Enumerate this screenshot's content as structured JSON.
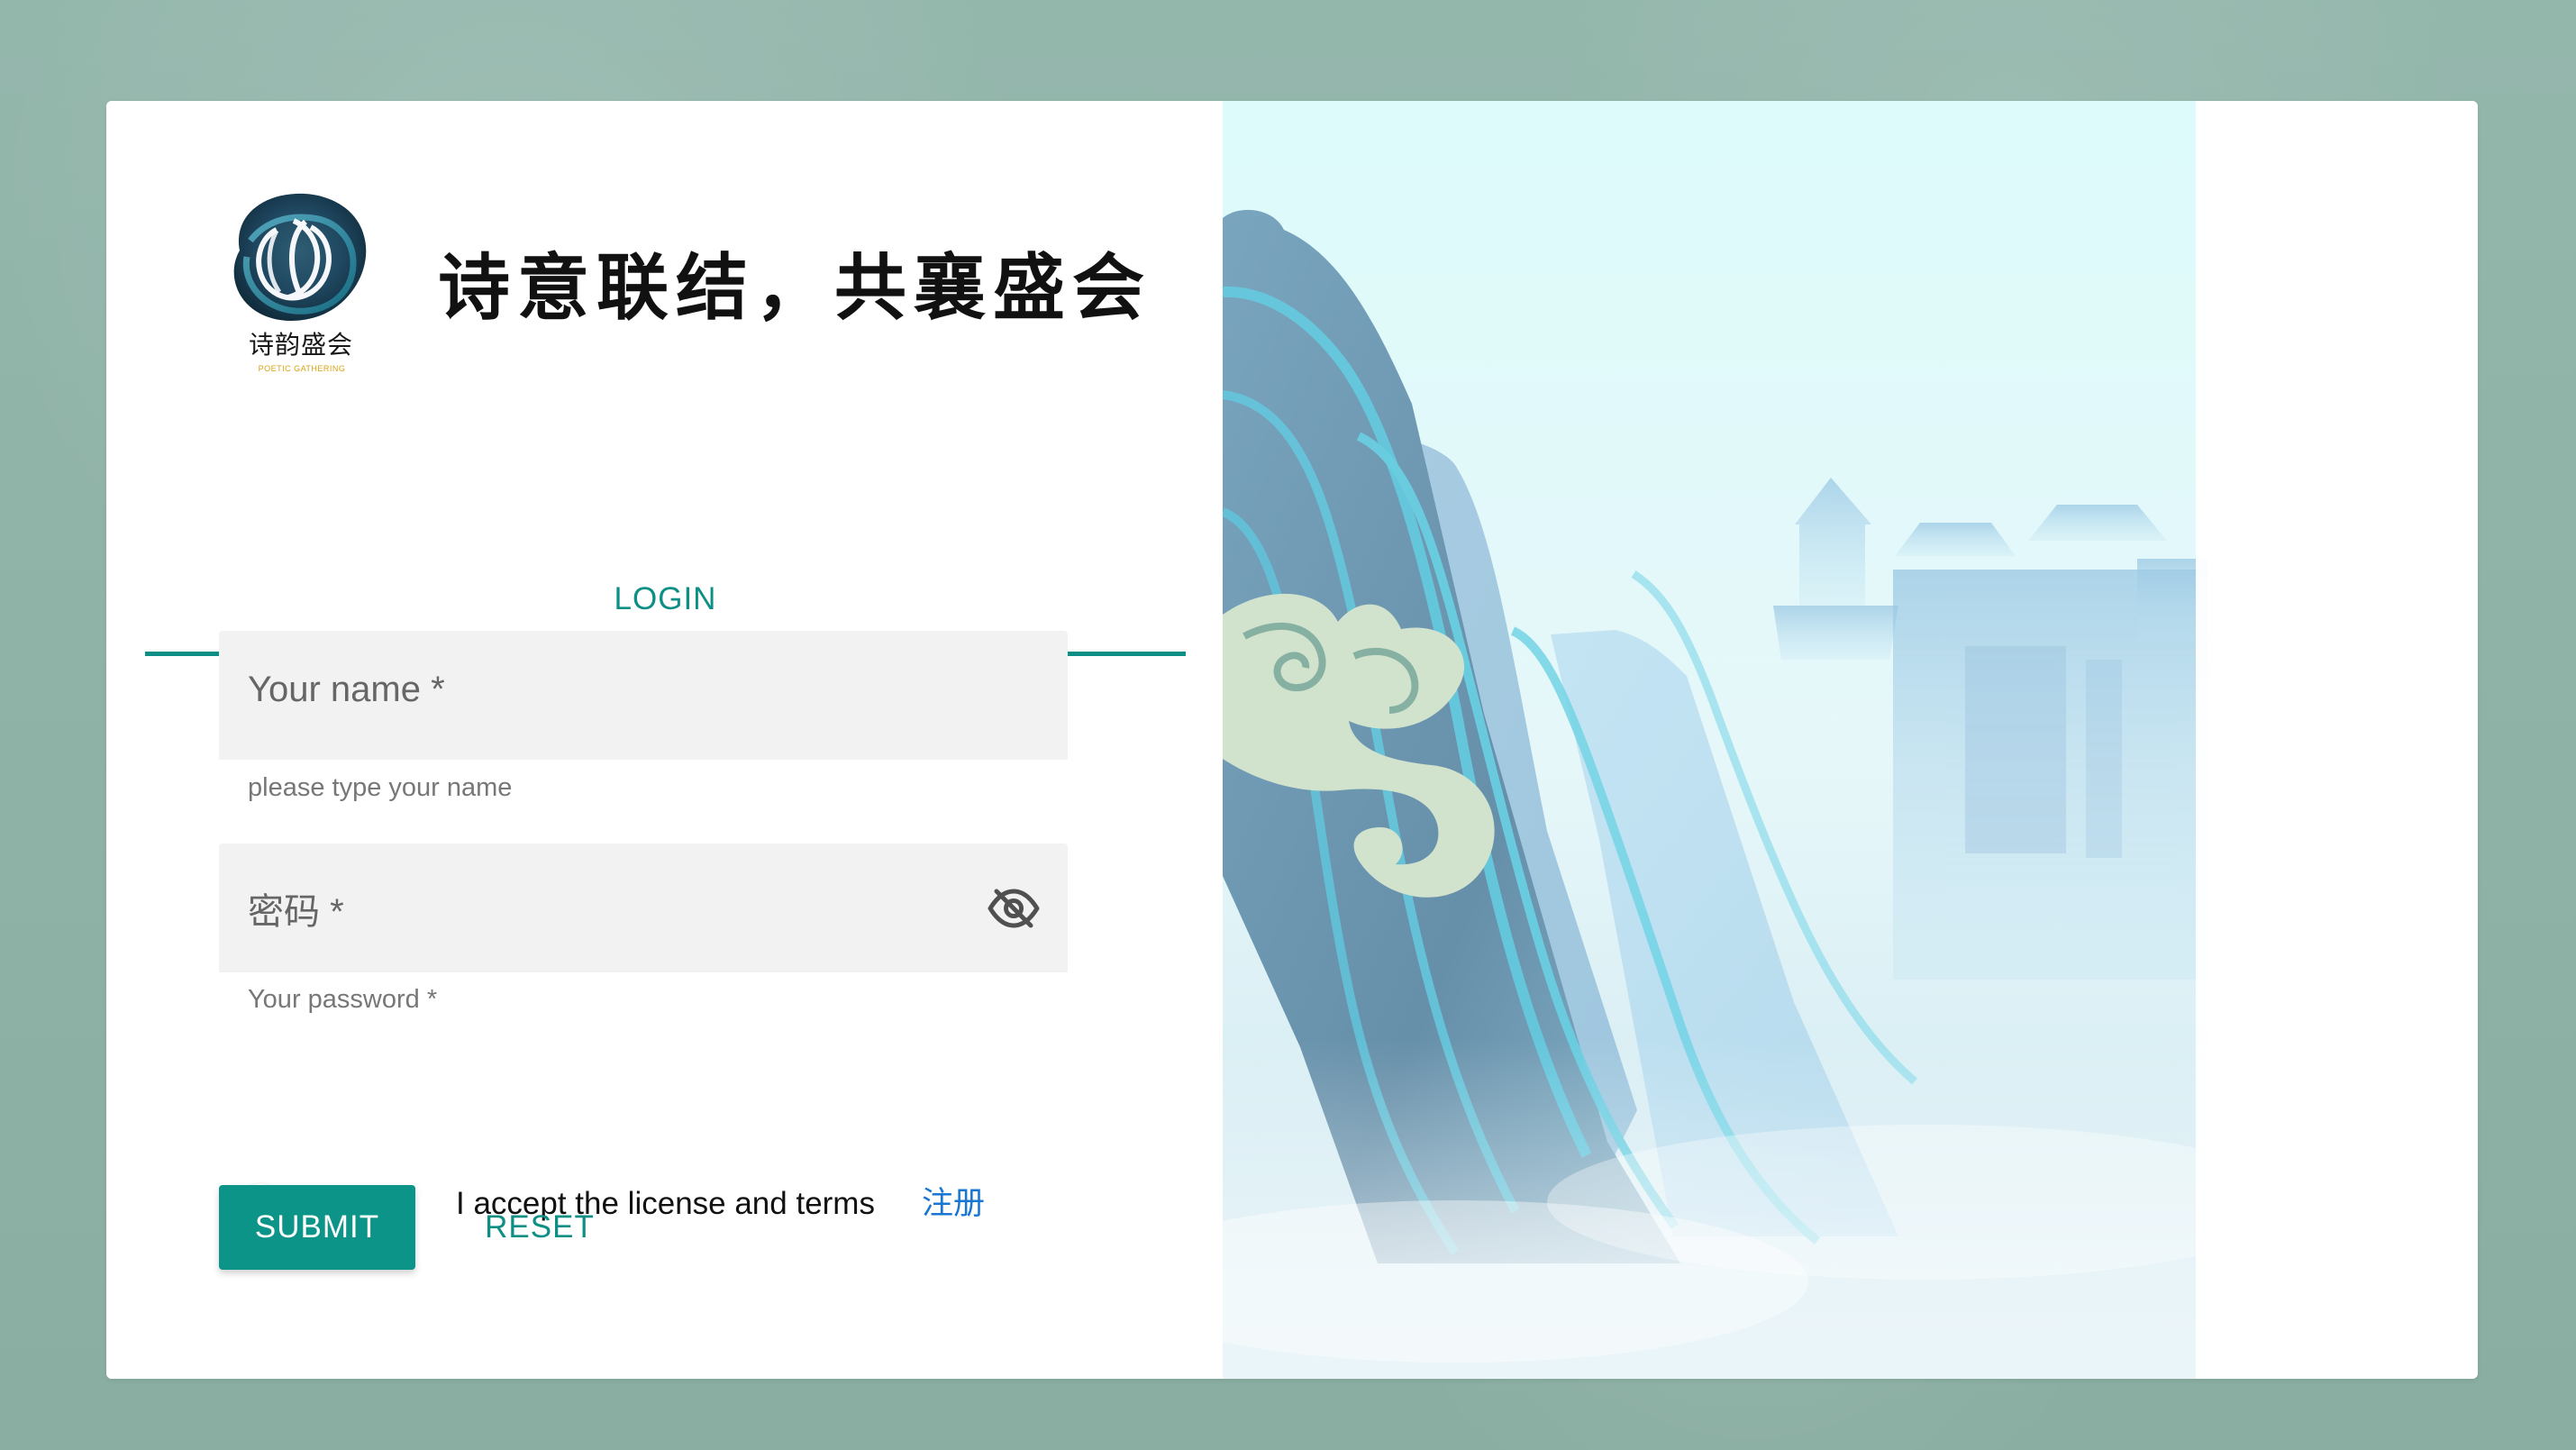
{
  "brand": {
    "subtitle": "诗韵盛会",
    "tagline": "POETIC GATHERING",
    "slogan": "诗意联结，共襄盛会"
  },
  "tabs": {
    "login": "LOGIN"
  },
  "form": {
    "name_label": "Your name *",
    "name_hint": "please type your name",
    "password_label": "密码 *",
    "password_hint": "Your password *",
    "terms_text": "I accept the license and terms",
    "register_link": "注册",
    "submit_label": "SUBMIT",
    "reset_label": "RESET",
    "terms_accepted": false
  },
  "colors": {
    "background": "#8fb3a8",
    "accent": "#0d9488",
    "tab_text": "#0d8f85",
    "link": "#1976d2"
  },
  "icons": {
    "password_visibility": "visibility-off-icon",
    "logo": "poetic-logo-icon"
  }
}
